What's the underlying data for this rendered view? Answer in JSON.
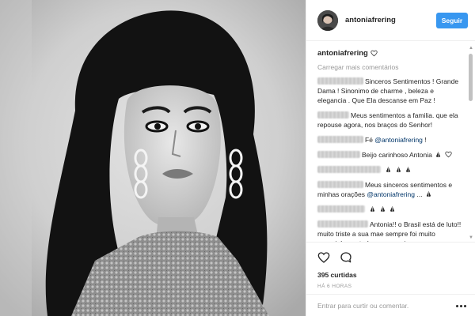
{
  "header": {
    "username": "antoniafrering",
    "follow_label": "Seguir"
  },
  "caption": {
    "username": "antoniafrering",
    "icon": "heart-outline-icon"
  },
  "load_more_label": "Carregar mais comentários",
  "comments": [
    {
      "text": "Sinceros Sentimentos ! Grande Dama ! Sinonimo de charme , beleza e elegancia . Que Ela descanse em Paz !"
    },
    {
      "text": "Meus sentimentos a familia. que ela repouse agora, nos braços do Senhor!"
    },
    {
      "text_before": "Fé",
      "mention": "@antoniafrering",
      "text_after": "!"
    },
    {
      "text": "Beijo carinhoso Antonia",
      "emojis": [
        "pray-hands-icon",
        "heart-outline-icon"
      ]
    },
    {
      "text": "",
      "emojis": [
        "pray-hands-icon",
        "pray-hands-icon",
        "pray-hands-icon"
      ]
    },
    {
      "text_before": "Meus sinceros sentimentos e minhas orações",
      "mention": "@antoniafrering",
      "text_after": "...",
      "emojis": [
        "pray-hands-icon"
      ]
    },
    {
      "text": "",
      "emojis": [
        "pray-hands-icon",
        "pray-hands-icon",
        "pray-hands-icon"
      ]
    },
    {
      "text": "Antonia!! o Brasil está de luto!! muito triste a sua mae sempre foi muito especial para todos e para mim"
    }
  ],
  "actions": {
    "like_icon": "heart-outline-icon",
    "comment_icon": "comment-bubble-icon"
  },
  "likes_label": "395 curtidas",
  "time_label": "HÁ 6 HORAS",
  "add_comment": {
    "placeholder": "Entrar para curtir ou comentar."
  },
  "colors": {
    "accent": "#3897f0",
    "mention": "#003569",
    "muted": "#999999",
    "border": "#efefef"
  }
}
